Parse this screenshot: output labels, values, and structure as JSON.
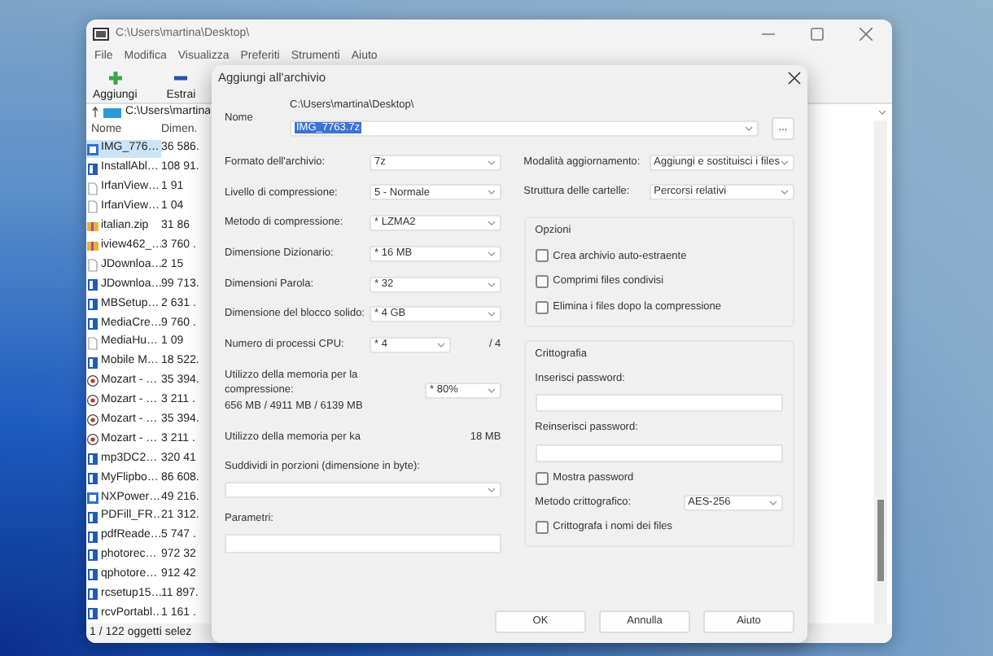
{
  "main_window": {
    "title": "C:\\Users\\martina\\Desktop\\",
    "menu": [
      "File",
      "Modifica",
      "Visualizza",
      "Preferiti",
      "Strumenti",
      "Aiuto"
    ],
    "toolbar": [
      {
        "label": "Aggiungi",
        "kind": "add"
      },
      {
        "label": "Estrai",
        "kind": "extract"
      }
    ],
    "address": "C:\\Users\\martina",
    "columns": [
      "Nome",
      "Dimen."
    ],
    "files": [
      {
        "name": "IMG_776…",
        "size": "36 586.",
        "kind": "image",
        "selected": true
      },
      {
        "name": "InstallAbl…",
        "size": "108 91.",
        "kind": "app",
        "selected": false
      },
      {
        "name": "IrfanView…",
        "size": "1 91",
        "kind": "doc",
        "selected": false
      },
      {
        "name": "IrfanView…",
        "size": "1 04",
        "kind": "doc",
        "selected": false
      },
      {
        "name": "italian.zip",
        "size": "31 86",
        "kind": "zip",
        "selected": false
      },
      {
        "name": "iview462_…",
        "size": "3 760 .",
        "kind": "zip",
        "selected": false
      },
      {
        "name": "JDownloa…",
        "size": "2 15",
        "kind": "doc",
        "selected": false
      },
      {
        "name": "JDownloa…",
        "size": "99 713.",
        "kind": "app",
        "selected": false
      },
      {
        "name": "MBSetup…",
        "size": "2 631 .",
        "kind": "app",
        "selected": false
      },
      {
        "name": "MediaCre…",
        "size": "9 760 .",
        "kind": "app",
        "selected": false
      },
      {
        "name": "MediaHu…",
        "size": "1 09",
        "kind": "doc",
        "selected": false
      },
      {
        "name": "Mobile M…",
        "size": "18 522.",
        "kind": "app",
        "selected": false
      },
      {
        "name": "Mozart - …",
        "size": "35 394.",
        "kind": "music",
        "selected": false
      },
      {
        "name": "Mozart - …",
        "size": "3 211 .",
        "kind": "music",
        "selected": false
      },
      {
        "name": "Mozart - …",
        "size": "35 394.",
        "kind": "music",
        "selected": false
      },
      {
        "name": "Mozart - …",
        "size": "3 211 .",
        "kind": "music",
        "selected": false
      },
      {
        "name": "mp3DC2…",
        "size": "320 41",
        "kind": "app",
        "selected": false
      },
      {
        "name": "MyFlipbo…",
        "size": "86 608.",
        "kind": "app",
        "selected": false
      },
      {
        "name": "NXPower…",
        "size": "49 216.",
        "kind": "image",
        "selected": false
      },
      {
        "name": "PDFill_FR…",
        "size": "21 312.",
        "kind": "app",
        "selected": false
      },
      {
        "name": "pdfReade…",
        "size": "5 747 .",
        "kind": "app",
        "selected": false
      },
      {
        "name": "photorec…",
        "size": "972 32",
        "kind": "app",
        "selected": false
      },
      {
        "name": "qphotore…",
        "size": "912 42",
        "kind": "app",
        "selected": false
      },
      {
        "name": "rcsetup15…",
        "size": "11 897.",
        "kind": "app",
        "selected": false
      },
      {
        "name": "rcvPortabl…",
        "size": "1 161 .",
        "kind": "app",
        "selected": false
      }
    ],
    "status": "1 / 122 oggetti selez"
  },
  "dialog": {
    "title": "Aggiungi all'archivio",
    "name_label": "Nome",
    "path": "C:\\Users\\martina\\Desktop\\",
    "archive_name": "IMG_7763.7z",
    "browse": "...",
    "left_fields": [
      {
        "kind": "select",
        "label": "Formato dell'archivio:",
        "value": "7z"
      },
      {
        "kind": "select",
        "label": "Livello di compressione:",
        "value": "5 - Normale"
      },
      {
        "kind": "select",
        "label": "Metodo di compressione:",
        "value": "* LZMA2"
      },
      {
        "kind": "select",
        "label": "Dimensione Dizionario:",
        "value": "* 16 MB"
      },
      {
        "kind": "select",
        "label": "Dimensioni Parola:",
        "value": "* 32"
      },
      {
        "kind": "select",
        "label": "Dimensione del blocco solido:",
        "value": "* 4 GB"
      },
      {
        "kind": "select_suffix",
        "label": "Numero di processi CPU:",
        "value": "* 4",
        "suffix": "/ 4"
      },
      {
        "kind": "memory",
        "label": "Utilizzo della memoria per la compressione:",
        "detail": "656 MB / 4911 MB / 6139 MB",
        "value": "* 80%"
      },
      {
        "kind": "info",
        "label": "Utilizzo della memoria per ka",
        "value": "18 MB"
      },
      {
        "kind": "stacked_select",
        "label": "Suddividi in porzioni (dimensione in byte):"
      },
      {
        "kind": "stacked_input",
        "label": "Parametri:"
      }
    ],
    "right_fields": [
      {
        "label": "Modalità aggiornamento:",
        "value": "Aggiungi e sostituisci i files"
      },
      {
        "label": "Struttura delle cartelle:",
        "value": "Percorsi relativi"
      }
    ],
    "options": {
      "title": "Opzioni",
      "items": [
        {
          "label": "Crea archivio auto-estraente",
          "checked": false
        },
        {
          "label": "Comprimi files condivisi",
          "checked": false
        },
        {
          "label": "Elimina i files dopo la compressione",
          "checked": false
        }
      ]
    },
    "encryption": {
      "title": "Crittografia",
      "password_label": "Inserisci password:",
      "repeat_label": "Reinserisci password:",
      "show_password": {
        "label": "Mostra password",
        "checked": false
      },
      "method_label": "Metodo crittografico:",
      "method": "AES-256",
      "encrypt_names": {
        "label": "Crittografa i nomi dei files",
        "checked": false
      }
    },
    "buttons": [
      "OK",
      "Annulla",
      "Aiuto"
    ]
  }
}
